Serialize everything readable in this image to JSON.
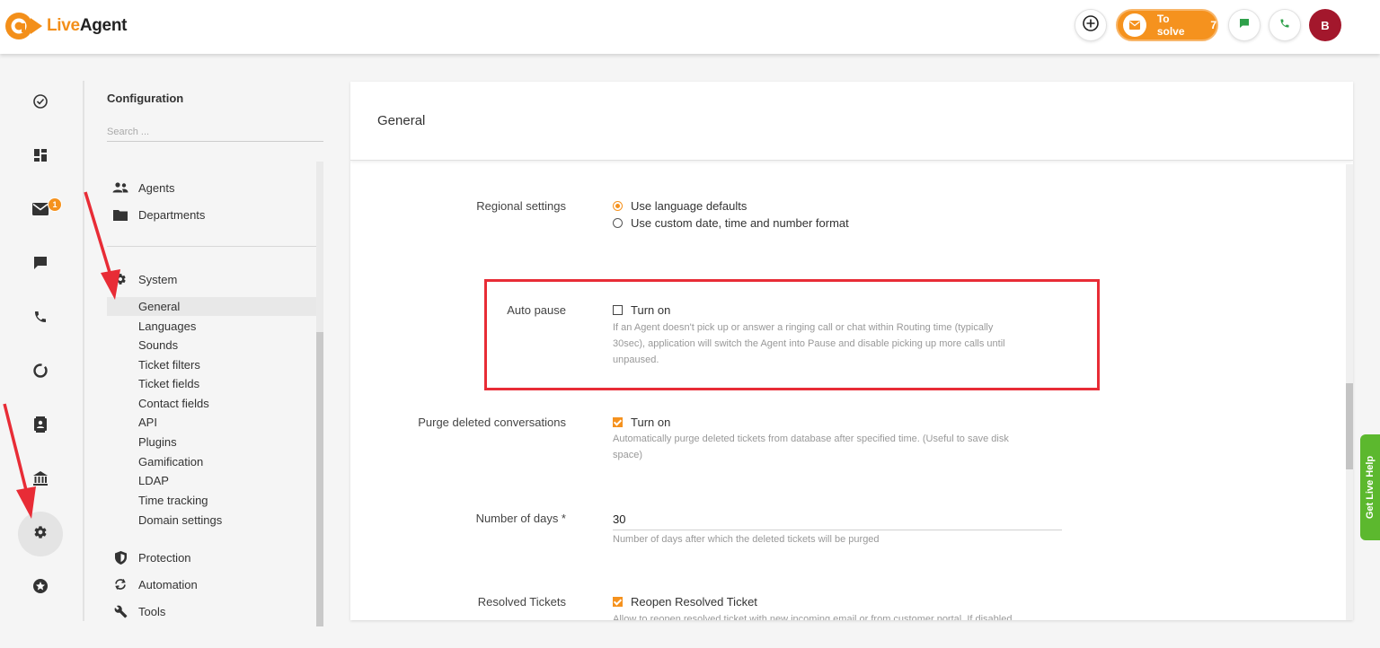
{
  "app": {
    "logo_live": "Live",
    "logo_agent": "Agent"
  },
  "topbar": {
    "to_solve_label": "To solve",
    "to_solve_count": "7",
    "avatar_initial": "B"
  },
  "rail": {
    "email_badge": "1"
  },
  "config": {
    "title": "Configuration",
    "search_placeholder": "Search ...",
    "groups": {
      "agents": "Agents",
      "departments": "Departments",
      "system": "System",
      "protection": "Protection",
      "automation": "Automation",
      "tools": "Tools"
    },
    "system_items": [
      "General",
      "Languages",
      "Sounds",
      "Ticket filters",
      "Ticket fields",
      "Contact fields",
      "API",
      "Plugins",
      "Gamification",
      "LDAP",
      "Time tracking",
      "Domain settings"
    ]
  },
  "main": {
    "title": "General",
    "regional": {
      "label": "Regional settings",
      "option1": "Use language defaults",
      "option2": "Use custom date, time and number format"
    },
    "auto_pause": {
      "label": "Auto pause",
      "option": "Turn on",
      "desc1": "If an Agent doesn't pick up or answer a ringing call or chat within Routing time (typically",
      "desc2": "30sec), application will switch the Agent into Pause and disable picking up more calls until",
      "desc3": "unpaused."
    },
    "purge": {
      "label": "Purge deleted conversations",
      "option": "Turn on",
      "desc1": "Automatically purge deleted tickets from database after specified time. (Useful to save disk",
      "desc2": "space)"
    },
    "days": {
      "label": "Number of days *",
      "value": "30",
      "desc": "Number of days after which the deleted tickets will be purged"
    },
    "resolved": {
      "label": "Resolved Tickets",
      "option": "Reopen Resolved Ticket",
      "desc": "Allow to reopen resolved ticket with new incoming email or from customer portal. If disabled,"
    }
  },
  "live_help": "Get Live Help",
  "colors": {
    "accent": "#f5921e",
    "highlight": "#e82c36",
    "avatar": "#a3172c",
    "live_help": "#5cb82e"
  }
}
